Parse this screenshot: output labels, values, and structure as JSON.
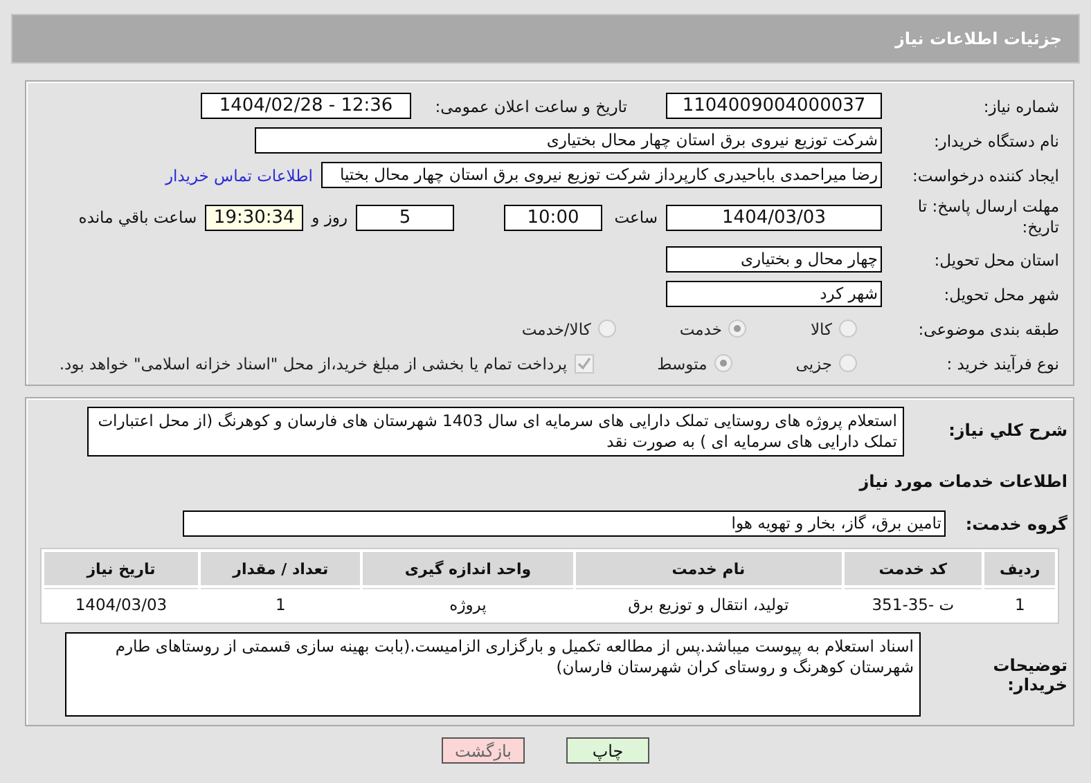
{
  "header": {
    "title": "جزئیات اطلاعات نیاز"
  },
  "details": {
    "need_number": {
      "label": "شماره نیاز:",
      "value": "1104009004000037"
    },
    "announce": {
      "label": "تاریخ و ساعت اعلان عمومی:",
      "value": "1404/02/28 - 12:36"
    },
    "buyer": {
      "label": "نام دستگاه خریدار:",
      "value": "شرکت توزیع نیروی برق استان چهار محال بختیاری"
    },
    "creator": {
      "label": "ایجاد کننده درخواست:",
      "value": "رضا میراحمدی باباحیدری کارپرداز شرکت توزیع نیروی برق استان چهار محال بختیا",
      "link": "اطلاعات تماس خریدار"
    },
    "deadline": {
      "label": "مهلت ارسال پاسخ: تا تاریخ:",
      "date": "1404/03/03",
      "time_label": "ساعت",
      "time": "10:00",
      "days": "5",
      "days_label": "روز و",
      "remaining": "19:30:34",
      "remaining_label": "ساعت باقي مانده"
    },
    "province": {
      "label": "استان محل تحویل:",
      "value": "چهار محال و بختیاری"
    },
    "city": {
      "label": "شهر محل تحویل:",
      "value": "شهر کرد"
    },
    "category": {
      "label": "طبقه بندی موضوعی:",
      "options": [
        {
          "label": "کالا",
          "selected": false
        },
        {
          "label": "خدمت",
          "selected": true
        },
        {
          "label": "کالا/خدمت",
          "selected": false
        }
      ]
    },
    "process": {
      "label": "نوع فرآیند خرید :",
      "options": [
        {
          "label": "جزیی",
          "selected": false
        },
        {
          "label": "متوسط",
          "selected": true
        }
      ],
      "treasury": {
        "checked": true,
        "label": "پرداخت تمام یا بخشی از مبلغ خرید،از محل \"اسناد خزانه اسلامی\" خواهد بود."
      }
    }
  },
  "services": {
    "summary": {
      "label": "شرح کلي نياز:",
      "value": "استعلام پروژه های روستایی تملک دارایی های سرمایه ای سال 1403 شهرستان های فارسان و کوهرنگ (از محل اعتبارات تملک دارایی های سرمایه ای ) به صورت نقد"
    },
    "heading": "اطلاعات خدمات مورد نیاز",
    "group": {
      "label": "گروه خدمت:",
      "value": "تامین برق، گاز، بخار و تهویه هوا"
    },
    "table": {
      "columns": [
        "ردیف",
        "کد خدمت",
        "نام خدمت",
        "واحد اندازه گیری",
        "تعداد / مقدار",
        "تاریخ نیاز"
      ],
      "rows": [
        [
          "1",
          "ت -35-351",
          "تولید، انتقال و توزیع برق",
          "پروژه",
          "1",
          "1404/03/03"
        ]
      ]
    },
    "notes": {
      "label": "توضیحات خریدار:",
      "value": "اسناد استعلام به پیوست میباشد.پس از مطالعه تکمیل و بارگزاری الزامیست.(بابت بهینه سازی قسمتی از روستاهای طارم شهرستان کوهرنگ و روستای کران شهرستان فارسان)"
    }
  },
  "buttons": [
    {
      "kind": "print",
      "label": "چاپ"
    },
    {
      "kind": "back",
      "label": "بازگشت"
    }
  ]
}
